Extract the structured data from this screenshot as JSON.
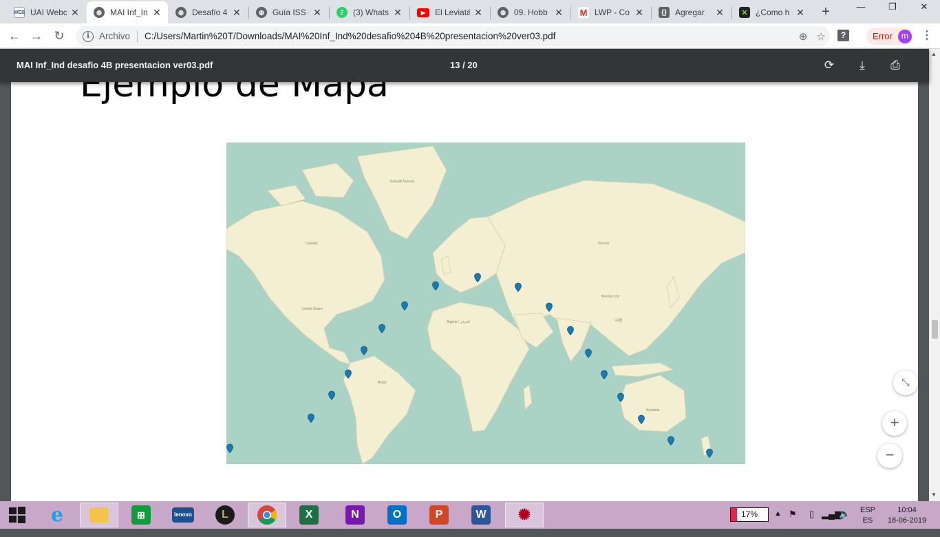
{
  "browser": {
    "tabs": [
      {
        "label": "UAI Webc",
        "favicon": "uai-favicon",
        "color": "#1a5fb4"
      },
      {
        "label": "MAI Inf_In",
        "favicon": "globe-icon",
        "color": "#5f6368"
      },
      {
        "label": "Desafío 4",
        "favicon": "globe-icon",
        "color": "#5f6368"
      },
      {
        "label": "Guía ISS (",
        "favicon": "globe-icon",
        "color": "#5f6368"
      },
      {
        "label": "(3) Whats",
        "favicon": "whatsapp-icon",
        "color": "#25d366",
        "badge": "2"
      },
      {
        "label": "El Leviatá",
        "favicon": "youtube-icon",
        "color": "#ff0000"
      },
      {
        "label": "09. Hobb",
        "favicon": "globe-icon",
        "color": "#5f6368"
      },
      {
        "label": "LWP - Co",
        "favicon": "gmail-icon",
        "color": "#d93025"
      },
      {
        "label": "Agregar",
        "favicon": "braces-icon",
        "color": "#5f6368"
      },
      {
        "label": "¿Como h",
        "favicon": "xda-icon",
        "color": "#1e8e3e"
      }
    ],
    "active_tab": 1,
    "address": {
      "scheme": "Archivo",
      "url": "C:/Users/Martin%20T/Downloads/MAI%20Inf_Ind%20desafio%204B%20presentacion%20ver03.pdf"
    },
    "profile": {
      "status": "Error",
      "initial": "m",
      "color": "#a142f4"
    }
  },
  "pdf": {
    "title": "MAI Inf_Ind desafio 4B presentacion ver03.pdf",
    "page_indicator": "13 / 20",
    "slide_title": "Ejemplo de Mapa",
    "map": {
      "ocean_color": "#aad3c5",
      "land_color": "#f2efd2"
    }
  },
  "taskbar": {
    "apps": [
      "start-icon",
      "internet-explorer-icon",
      "file-explorer-icon",
      "store-icon",
      "lenovo-icon",
      "league-icon",
      "chrome-icon",
      "excel-icon",
      "onenote-icon",
      "outlook-icon",
      "powerpoint-icon",
      "word-icon",
      "spider-icon"
    ],
    "battery": "17%",
    "battery_level": 0.17,
    "lang_top": "ESP",
    "lang_bottom": "ES",
    "time": "10:04",
    "date": "18-06-2019"
  }
}
